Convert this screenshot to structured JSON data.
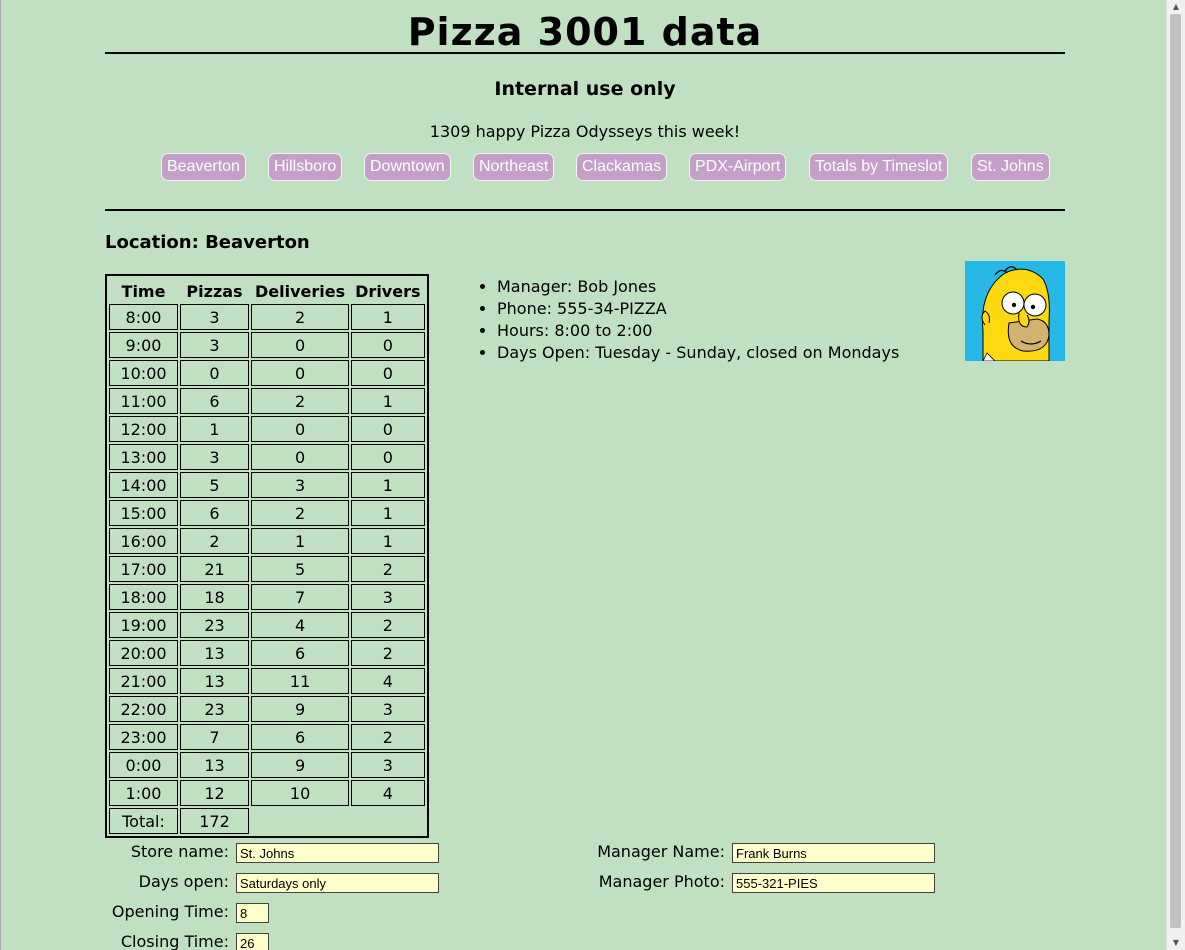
{
  "header": {
    "title": "Pizza 3001 data",
    "subtitle": "Internal use only",
    "happy_line": "1309 happy Pizza Odysseys this week!"
  },
  "nav": {
    "items": [
      "Beaverton",
      "Hillsboro",
      "Downtown",
      "Northeast",
      "Clackamas",
      "PDX-Airport",
      "Totals by Timeslot",
      "St. Johns"
    ]
  },
  "location": {
    "heading": "Location: Beaverton"
  },
  "table": {
    "headers": [
      "Time",
      "Pizzas",
      "Deliveries",
      "Drivers"
    ],
    "rows": [
      [
        "8:00",
        "3",
        "2",
        "1"
      ],
      [
        "9:00",
        "3",
        "0",
        "0"
      ],
      [
        "10:00",
        "0",
        "0",
        "0"
      ],
      [
        "11:00",
        "6",
        "2",
        "1"
      ],
      [
        "12:00",
        "1",
        "0",
        "0"
      ],
      [
        "13:00",
        "3",
        "0",
        "0"
      ],
      [
        "14:00",
        "5",
        "3",
        "1"
      ],
      [
        "15:00",
        "6",
        "2",
        "1"
      ],
      [
        "16:00",
        "2",
        "1",
        "1"
      ],
      [
        "17:00",
        "21",
        "5",
        "2"
      ],
      [
        "18:00",
        "18",
        "7",
        "3"
      ],
      [
        "19:00",
        "23",
        "4",
        "2"
      ],
      [
        "20:00",
        "13",
        "6",
        "2"
      ],
      [
        "21:00",
        "13",
        "11",
        "4"
      ],
      [
        "22:00",
        "23",
        "9",
        "3"
      ],
      [
        "23:00",
        "7",
        "6",
        "2"
      ],
      [
        "0:00",
        "13",
        "9",
        "3"
      ],
      [
        "1:00",
        "12",
        "10",
        "4"
      ]
    ],
    "total_label": "Total:",
    "total_value": "172"
  },
  "info": {
    "items": [
      "Manager: Bob Jones",
      "Phone: 555-34-PIZZA",
      "Hours: 8:00 to 2:00",
      "Days Open: Tuesday - Sunday, closed on Mondays"
    ]
  },
  "form": {
    "store_name_label": "Store name:",
    "store_name_value": "St. Johns",
    "days_open_label": "Days open:",
    "days_open_value": "Saturdays only",
    "opening_time_label": "Opening Time:",
    "opening_time_value": "8",
    "closing_time_label": "Closing Time:",
    "closing_time_value": "26",
    "manager_name_label": "Manager Name:",
    "manager_name_value": "Frank Burns",
    "manager_photo_label": "Manager Photo:",
    "manager_photo_value": "555-321-PIES"
  },
  "colors": {
    "background": "#c1dfc1",
    "nav_button": "#c4a0c8",
    "input_background": "#ffffcc",
    "avatar_background": "#27b8e8"
  },
  "icons": {
    "avatar": "homer-simpson-avatar"
  }
}
